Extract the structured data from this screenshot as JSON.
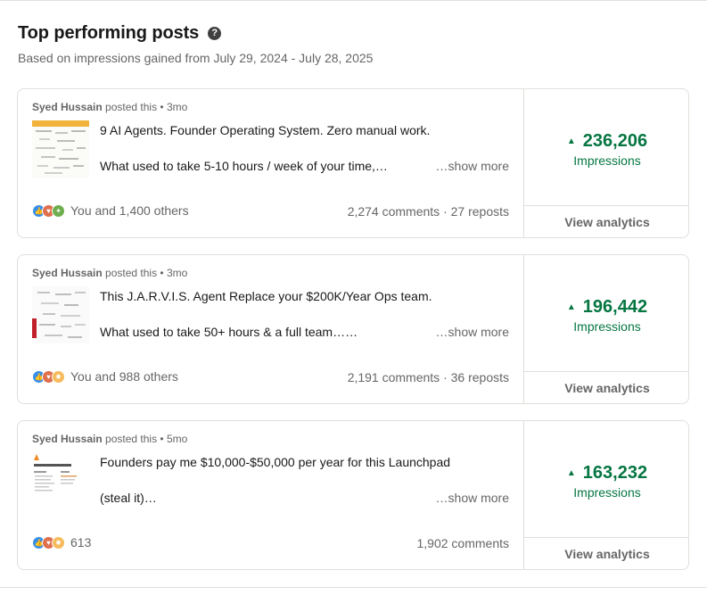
{
  "header": {
    "title": "Top performing posts",
    "subtitle": "Based on impressions gained from July 29, 2024 - July 28, 2025"
  },
  "common": {
    "show_more": "…show more",
    "view_analytics": "View analytics",
    "impressions_label": "Impressions",
    "posted_this": "posted this •"
  },
  "posts": [
    {
      "author": "Syed Hussain",
      "age": "3mo",
      "line1": "9 AI Agents. Founder Operating System. Zero manual work.",
      "line2": "What used to take 5-10 hours / week of your time,…",
      "reactions_text": "You and 1,400 others",
      "reaction_icons": [
        "like-icon",
        "love-icon",
        "support-icon"
      ],
      "engagement": "2,274 comments · 27 reposts",
      "impressions": "236,206"
    },
    {
      "author": "Syed Hussain",
      "age": "3mo",
      "line1": "This J.A.R.V.I.S. Agent Replace your $200K/Year Ops team.",
      "line2": "What used to take 50+ hours & a full team……",
      "reactions_text": "You and 988 others",
      "reaction_icons": [
        "like-icon",
        "love-icon",
        "insight-icon"
      ],
      "engagement": "2,191 comments · 36 reposts",
      "impressions": "196,442"
    },
    {
      "author": "Syed Hussain",
      "age": "5mo",
      "line1": "Founders pay me $10,000-$50,000 per year for this Launchpad",
      "line2": "(steal it)…",
      "reactions_text": "613",
      "reaction_icons": [
        "like-icon",
        "love-icon",
        "insight-icon"
      ],
      "engagement": "1,902 comments",
      "impressions": "163,232"
    }
  ],
  "colors": {
    "accent_green": "#057642",
    "muted_text": "#666666",
    "border": "#e0dfdc"
  }
}
